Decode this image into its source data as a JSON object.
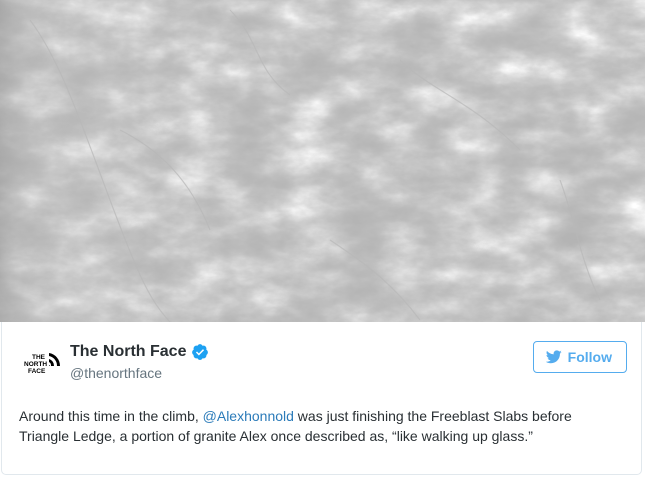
{
  "tweet": {
    "display_name": "The North Face",
    "handle": "@thenorthface",
    "logo_text": [
      "THE",
      "NORTH",
      "FACE"
    ],
    "follow_label": "Follow",
    "text_before": "Around this time in the climb, ",
    "mention": "@Alexhonnold",
    "text_after": " was just finishing the Freeblast Slabs before Triangle Ledge, a portion of granite Alex once described as, “like walking up glass.”"
  },
  "icons": {
    "verified": "verified-badge-icon",
    "twitter": "twitter-bird-icon",
    "logo": "the-north-face-logo"
  },
  "colors": {
    "accent": "#55acee",
    "link": "#2b7bb9",
    "verified": "#1da1f2",
    "muted": "#66757f",
    "text": "#292f33"
  }
}
